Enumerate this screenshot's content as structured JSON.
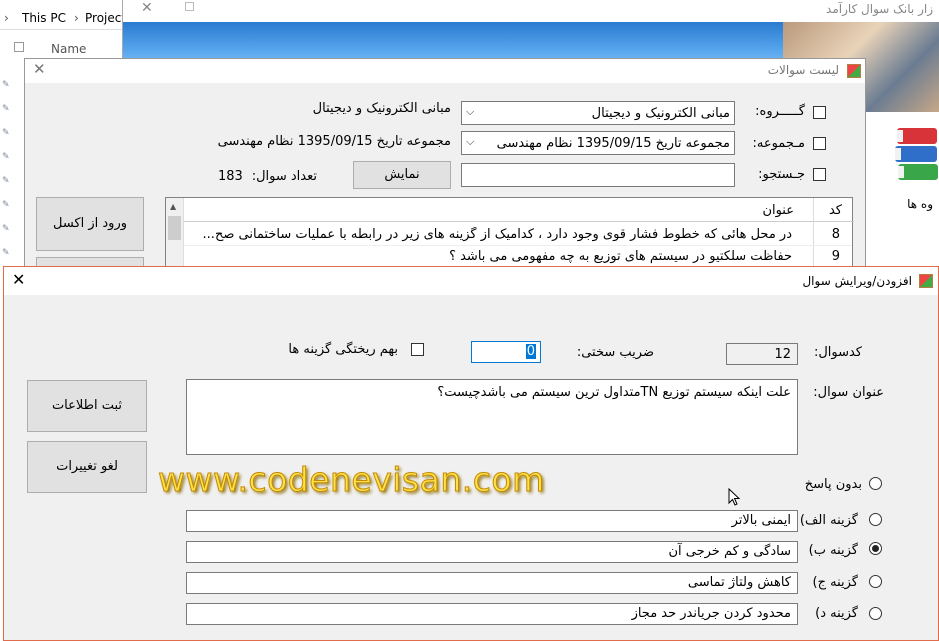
{
  "explorer": {
    "breadcrumb": [
      "This PC",
      "Project"
    ],
    "column_name": "Name"
  },
  "main_window": {
    "title": "زار بانک سوال کارآمد",
    "side_label": "وه ها"
  },
  "list_window": {
    "title": "لیست سوالات",
    "group_label": "گـــــروه:",
    "group_value": "مبانی الکترونیک و دیجیتال",
    "group_display": "مبانی الکترونیک و دیجیتال",
    "collection_label": "مـجموعه:",
    "collection_value": "مجموعه تاریخ 1395/09/15 نظام مهندسی",
    "collection_display": "مجموعه تاریخ 1395/09/15 نظام مهندسی",
    "search_label": "جـستجو:",
    "search_value": "",
    "show_button": "نمایش",
    "count_label": "تعداد سوال:",
    "count_value": "183",
    "import_button": "ورود از اکسل",
    "grid": {
      "col_code": "کد",
      "col_title": "عنوان",
      "rows": [
        {
          "code": "8",
          "title": "در محل هائی که خطوط فشار قوی وجود دارد ، کدامیک از گزینه های زیر در رابطه با عملیات ساختمانی صح..."
        },
        {
          "code": "9",
          "title": "حفاظت سلکتیو  در سیستم های توزیع به چه مفهومی می باشد ؟"
        }
      ]
    }
  },
  "edit_window": {
    "title": "افزودن/ویرایش سوال",
    "code_label": "کدسوال:",
    "code_value": "12",
    "difficulty_label": "ضریب سختی:",
    "difficulty_value": "0",
    "shuffle_label": "بهم ریختگی گزینه ها",
    "question_label": "عنوان سوال:",
    "question_value": "علت اینکه سیستم توزیع TNمتداول ترین سیستم می باشدچیست؟",
    "save_button": "ثبت اطلاعات",
    "cancel_button": "لغو تغییرات",
    "no_answer_label": "بدون پاسخ",
    "options": [
      {
        "label": "گزینه الف)",
        "value": "ایمنی بالاتر",
        "selected": false
      },
      {
        "label": "گزینه ب)",
        "value": "سادگی و کم خرجی آن",
        "selected": true
      },
      {
        "label": "گزینه ج)",
        "value": "کاهش ولتاژ تماسی",
        "selected": false
      },
      {
        "label": "گزینه د)",
        "value": "محدود کردن جریاندر حد مجاز",
        "selected": false
      }
    ]
  },
  "watermark": "www.codenevisan.com",
  "colors": {
    "dialog_border": "#e06c4c",
    "watermark": "#ffe24a",
    "window_bg": "#f0f0f0"
  }
}
